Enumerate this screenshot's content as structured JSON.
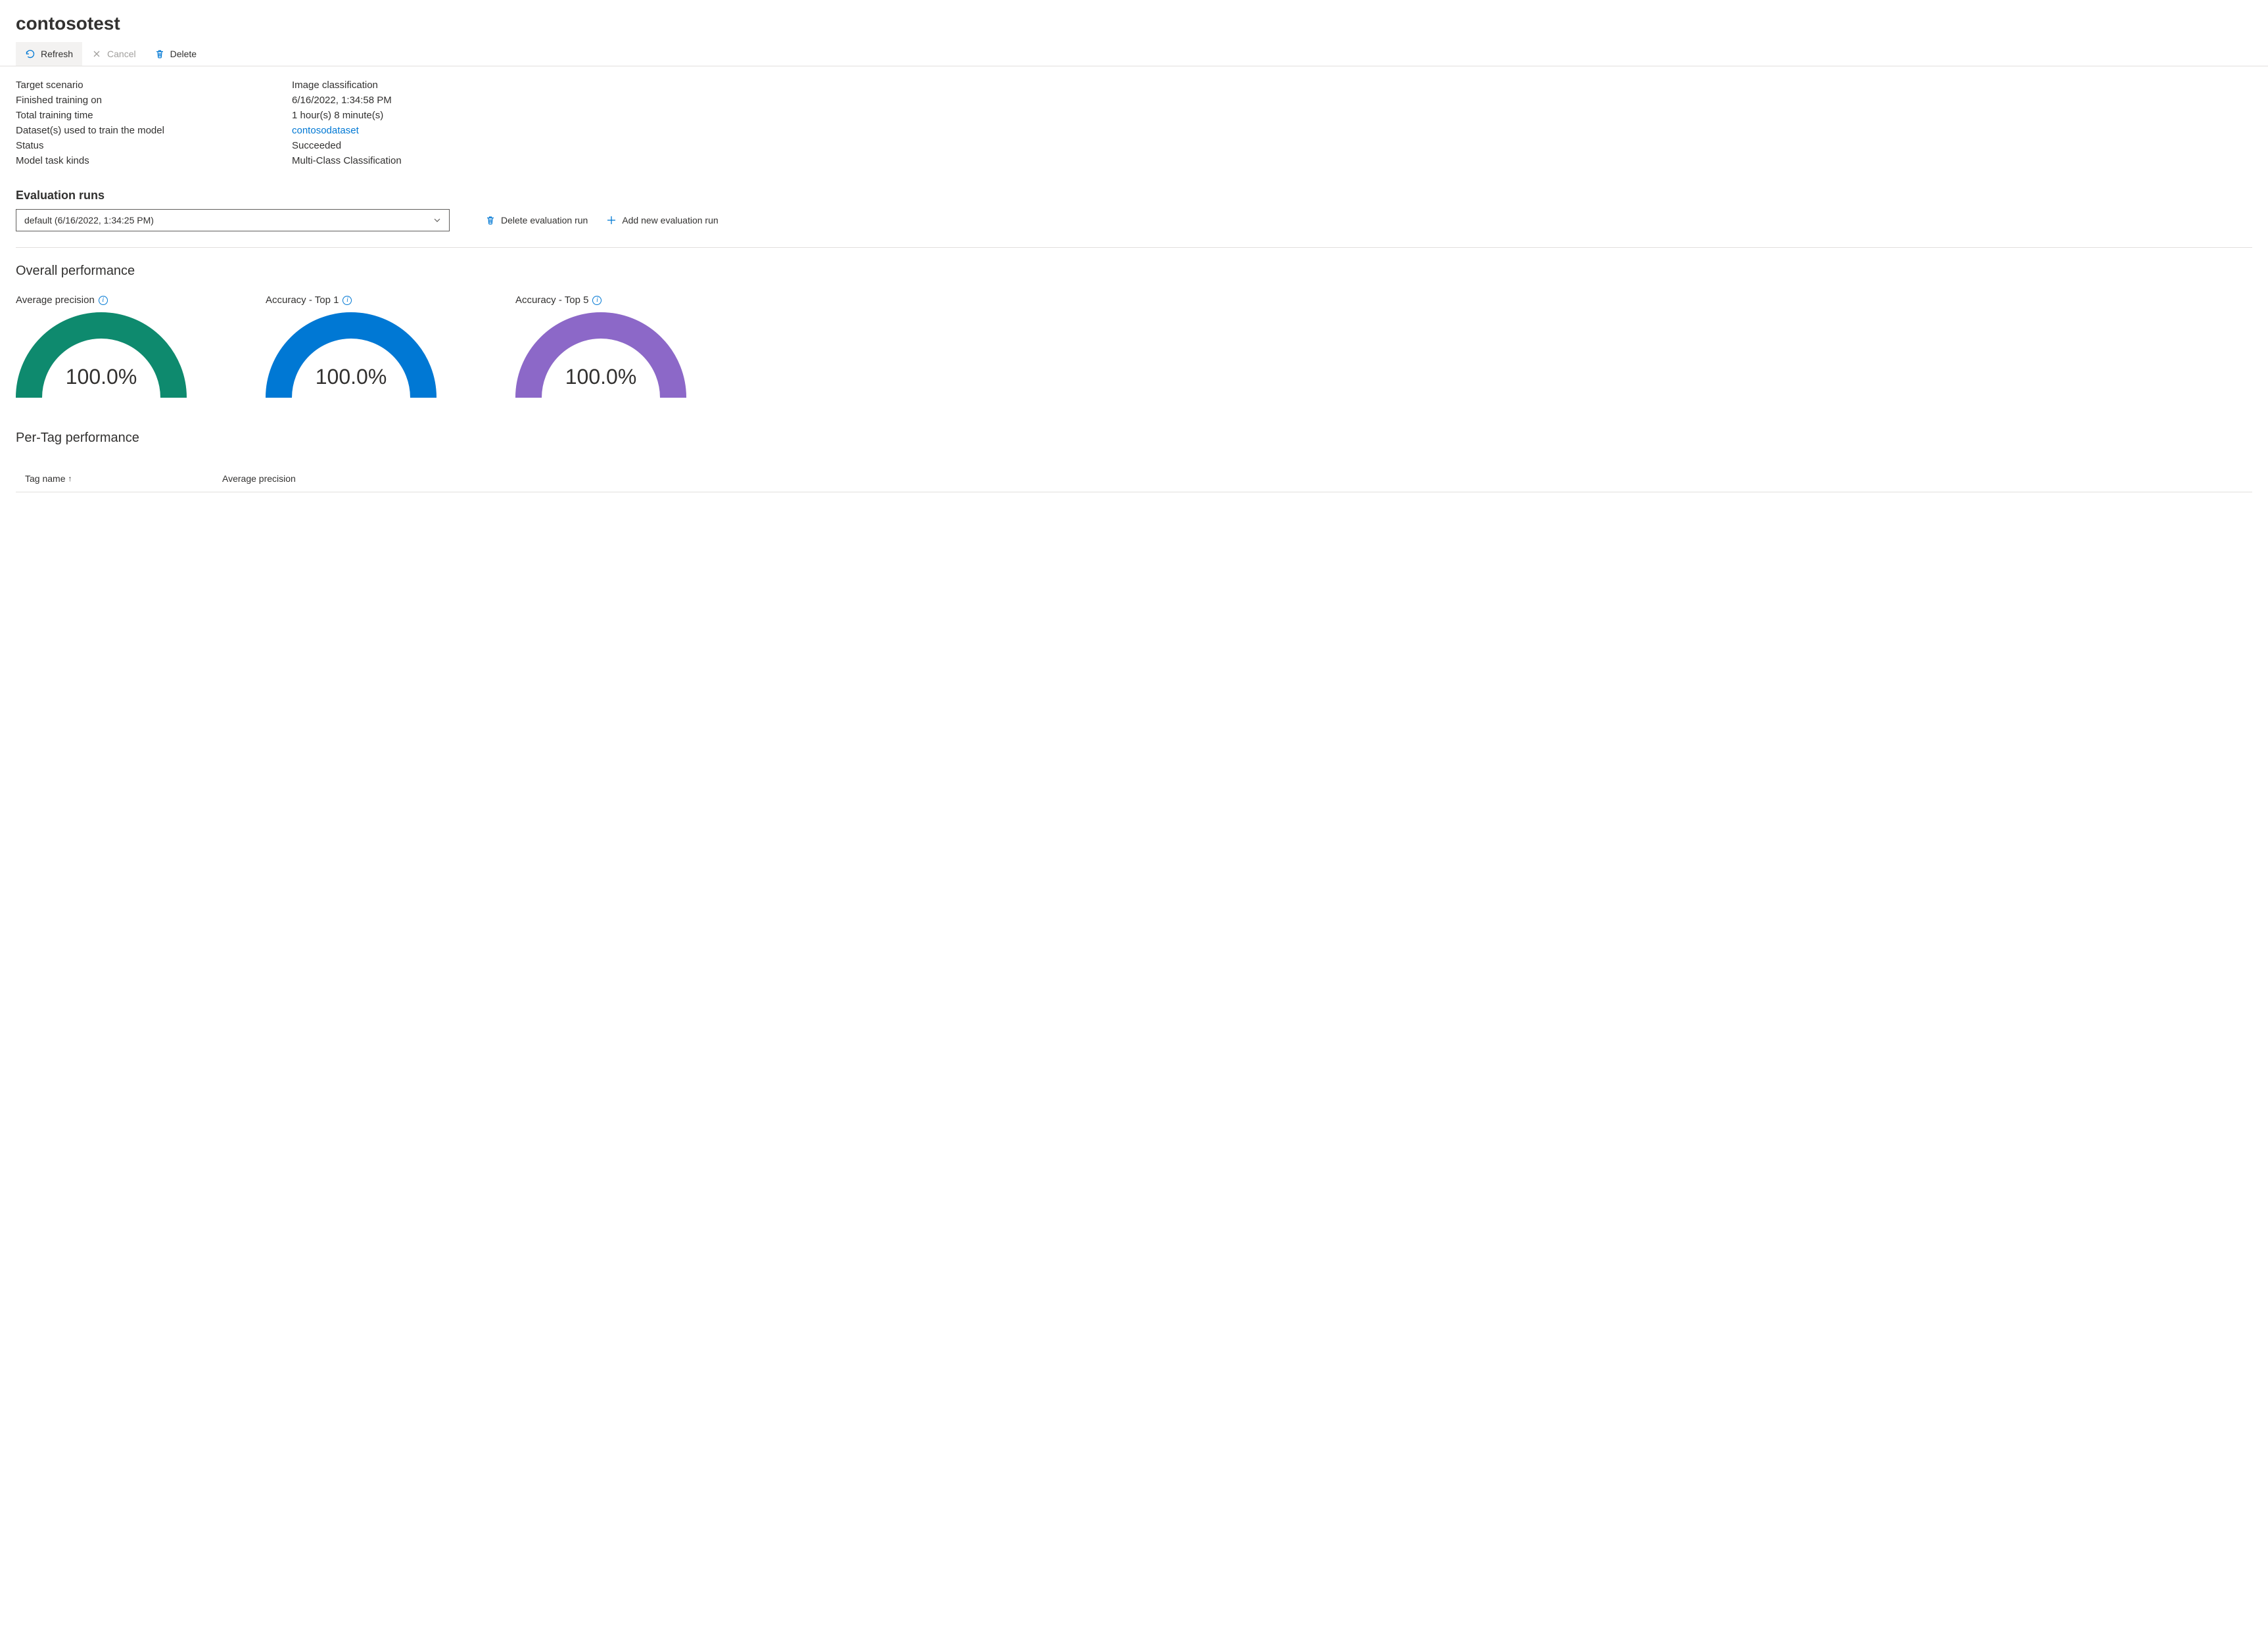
{
  "page_title": "contosotest",
  "toolbar": {
    "refresh": "Refresh",
    "cancel": "Cancel",
    "delete": "Delete"
  },
  "details": {
    "target_scenario_label": "Target scenario",
    "target_scenario_value": "Image classification",
    "finished_on_label": "Finished training on",
    "finished_on_value": "6/16/2022, 1:34:58 PM",
    "total_time_label": "Total training time",
    "total_time_value": "1 hour(s) 8 minute(s)",
    "datasets_label": "Dataset(s) used to train the model",
    "datasets_value": "contosodataset",
    "status_label": "Status",
    "status_value": "Succeeded",
    "model_task_label": "Model task kinds",
    "model_task_value": "Multi-Class Classification"
  },
  "eval_runs": {
    "section_title": "Evaluation runs",
    "selected": "default (6/16/2022, 1:34:25 PM)",
    "delete_label": "Delete evaluation run",
    "add_label": "Add new evaluation run"
  },
  "overall": {
    "title": "Overall performance",
    "metrics": [
      {
        "label": "Average precision",
        "value": "100.0%",
        "percent": 100,
        "color": "#0e8a6e"
      },
      {
        "label": "Accuracy - Top 1",
        "value": "100.0%",
        "percent": 100,
        "color": "#0078d4"
      },
      {
        "label": "Accuracy - Top 5",
        "value": "100.0%",
        "percent": 100,
        "color": "#8c68c8"
      }
    ]
  },
  "pertag": {
    "title": "Per-Tag performance",
    "columns": {
      "tag_name": "Tag name",
      "avg_precision": "Average precision"
    },
    "sort_indicator": "↑"
  },
  "chart_data": {
    "type": "gauge",
    "series": [
      {
        "name": "Average precision",
        "value": 100.0,
        "max": 100,
        "unit": "%",
        "color": "#0e8a6e"
      },
      {
        "name": "Accuracy - Top 1",
        "value": 100.0,
        "max": 100,
        "unit": "%",
        "color": "#0078d4"
      },
      {
        "name": "Accuracy - Top 5",
        "value": 100.0,
        "max": 100,
        "unit": "%",
        "color": "#8c68c8"
      }
    ],
    "title": "Overall performance"
  }
}
